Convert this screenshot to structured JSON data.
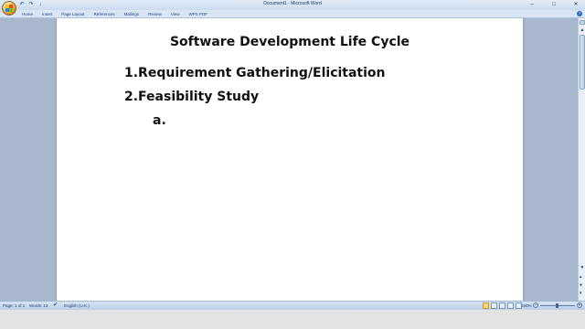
{
  "window": {
    "title": "Document1 - Microsoft Word",
    "qat": [
      "↶",
      "↷",
      "↓"
    ],
    "controls": {
      "minimize": "–",
      "maximize": "□",
      "close": "✕"
    }
  },
  "ribbon": {
    "tabs": [
      "Home",
      "Insert",
      "Page Layout",
      "References",
      "Mailings",
      "Review",
      "View",
      "WPS PDF"
    ],
    "help": "?"
  },
  "document": {
    "title": "Software Development Life Cycle",
    "items": [
      "1.Requirement Gathering/Elicitation",
      "2.Feasibility Study",
      "a."
    ]
  },
  "scrollbar": {
    "up": "▲",
    "down": "▼",
    "prev": "▴",
    "browse": "●",
    "next": "▾"
  },
  "status": {
    "page": "Page: 1 of 1",
    "words": "Words: 13",
    "proofing_icon": "✔",
    "language": "English (U.K.)",
    "zoom": "150%",
    "zoom_minus": "–",
    "zoom_plus": "+",
    "zoom_level": 0.5
  },
  "colors": {
    "accent": "#15428b",
    "page": "#ffffff",
    "workspace": "#a9b8cc"
  }
}
